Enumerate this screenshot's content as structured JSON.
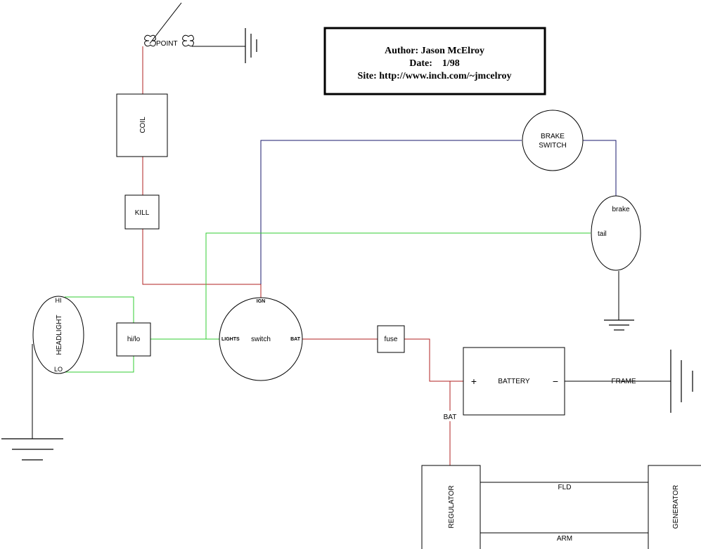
{
  "diagram": {
    "title_block": {
      "author_line": "Author:  Jason McElroy",
      "date_line": "Date:    1/98",
      "site_line": "Site:  http://www.inch.com/~jmcelroy"
    },
    "colors": {
      "ignition_wire": "#b22222",
      "brake_wire": "#1a1a6e",
      "lights_wire": "#33cc33",
      "power_wire": "#b22222",
      "ground_wire": "#000000"
    },
    "components": {
      "point": "POINT",
      "coil": "COIL",
      "kill": "KILL",
      "headlight": "HEADLIGHT",
      "headlight_hi": "HI",
      "headlight_lo": "LO",
      "hilo": "hi/lo",
      "switch": "switch",
      "switch_ign": "IGN",
      "switch_lights": "LIGHTS",
      "switch_bat": "BAT",
      "fuse": "fuse",
      "brake_switch_line1": "BRAKE",
      "brake_switch_line2": "SWITCH",
      "taillight_brake": "brake",
      "taillight_tail": "tail",
      "battery": "BATTERY",
      "battery_plus": "+",
      "battery_minus": "−",
      "frame": "FRAME",
      "bat_wire": "BAT",
      "regulator": "REGULATOR",
      "generator": "GENERATOR",
      "fld_wire": "FLD",
      "arm_wire": "ARM"
    }
  }
}
